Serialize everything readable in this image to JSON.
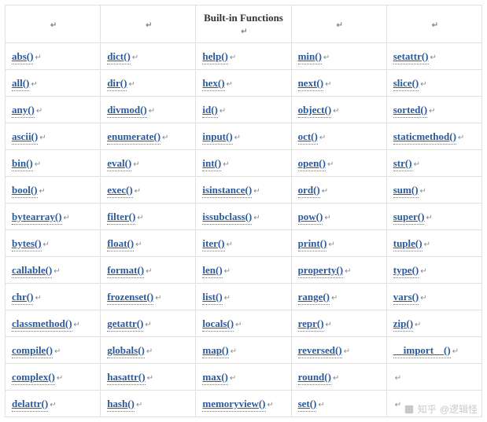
{
  "header": {
    "title": "Built-in Functions"
  },
  "marker": "↵",
  "table": {
    "cols": 5,
    "rows": [
      [
        "abs()",
        "dict()",
        "help()",
        "min()",
        "setattr()"
      ],
      [
        "all()",
        "dir()",
        "hex()",
        "next()",
        "slice()"
      ],
      [
        "any()",
        "divmod()",
        "id()",
        "object()",
        "sorted()"
      ],
      [
        "ascii()",
        "enumerate()",
        "input()",
        "oct()",
        "staticmethod()"
      ],
      [
        "bin()",
        "eval()",
        "int()",
        "open()",
        "str()"
      ],
      [
        "bool()",
        "exec()",
        "isinstance()",
        "ord()",
        "sum()"
      ],
      [
        "bytearray()",
        "filter()",
        "issubclass()",
        "pow()",
        "super()"
      ],
      [
        "bytes()",
        "float()",
        "iter()",
        "print()",
        "tuple()"
      ],
      [
        "callable()",
        "format()",
        "len()",
        "property()",
        "type()"
      ],
      [
        "chr()",
        "frozenset()",
        "list()",
        "range()",
        "vars()"
      ],
      [
        "classmethod()",
        "getattr()",
        "locals()",
        "repr()",
        "zip()"
      ],
      [
        "compile()",
        "globals()",
        "map()",
        "reversed()",
        "__import__()"
      ],
      [
        "complex()",
        "hasattr()",
        "max()",
        "round()",
        ""
      ],
      [
        "delattr()",
        "hash()",
        "memoryview()",
        "set()",
        ""
      ]
    ]
  },
  "watermark": {
    "source": "知乎",
    "author": "@逻辑怪"
  }
}
